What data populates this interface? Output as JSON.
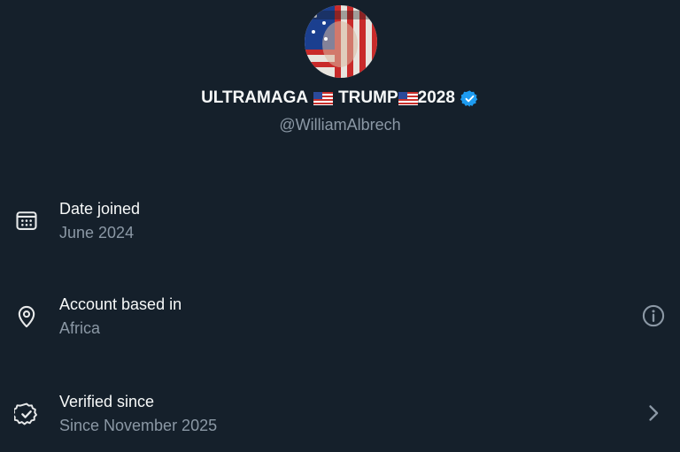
{
  "profile": {
    "name_part1": "ULTRAMAGA",
    "name_part2": "TRUMP",
    "name_part3": "2028",
    "handle": "@WilliamAlbrech",
    "avatar_icon": "avatar-flag-face",
    "verified_icon": "verified-badge-icon",
    "flag_icon": "us-flag-icon"
  },
  "rows": [
    {
      "icon": "calendar-icon",
      "title": "Date joined",
      "value": "June 2024"
    },
    {
      "icon": "location-pin-icon",
      "title": "Account based in",
      "value": "Africa",
      "trailing_icon": "info-icon"
    },
    {
      "icon": "verified-check-icon",
      "title": "Verified since",
      "value": "Since November 2025",
      "trailing_icon": "chevron-right-icon"
    }
  ],
  "colors": {
    "background": "#15202b",
    "primary_text": "#f7f9f9",
    "secondary_text": "#8b98a5",
    "verified_blue": "#1d9bf0"
  }
}
